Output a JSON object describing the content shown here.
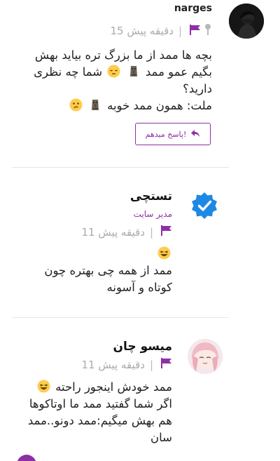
{
  "comments": [
    {
      "author": "narges",
      "time": "15 دقیقه پیش",
      "separator": "|",
      "body_lines": [
        "بچه ها ممد از ما بزرگ تره بیاید بهش",
        "بگیم عمو ممد",
        "شما چه نظری",
        "دارید؟",
        "ملت: همون ممد خوبه"
      ],
      "reply_label": "پاسخ میدهم!",
      "icons": [
        "pin-icon",
        "flag-icon",
        "moai-emoji",
        "relieved-face-emoji",
        "moai-emoji",
        "confused-face-emoji",
        "reply-arrow-icon"
      ]
    },
    {
      "author": "تستچی",
      "role": "مدیر سایت",
      "time": "11 دقیقه پیش",
      "separator": "|",
      "body_lines": [
        "ممد از همه چی بهتره چون",
        "کوتاه و آسونه"
      ],
      "icons": [
        "verified-badge-icon",
        "flag-icon",
        "laughing-face-emoji"
      ]
    },
    {
      "author": "میسو چان",
      "time": "11 دقیقه پیش",
      "separator": "|",
      "body_lines": [
        "ممد خودش اینجور راحته",
        "اگر شما گفتید ممد ما اوتاکوها",
        "هم بهش میگیم:ممد دونو..ممد",
        "سان"
      ],
      "icons": [
        "anime-girl-avatar",
        "flag-icon",
        "laughing-face-emoji"
      ]
    }
  ],
  "colors": {
    "accent": "#8d2fa5",
    "verified": "#1e88e5",
    "muted": "#aaaaaa",
    "divider": "#e6e6e6"
  }
}
